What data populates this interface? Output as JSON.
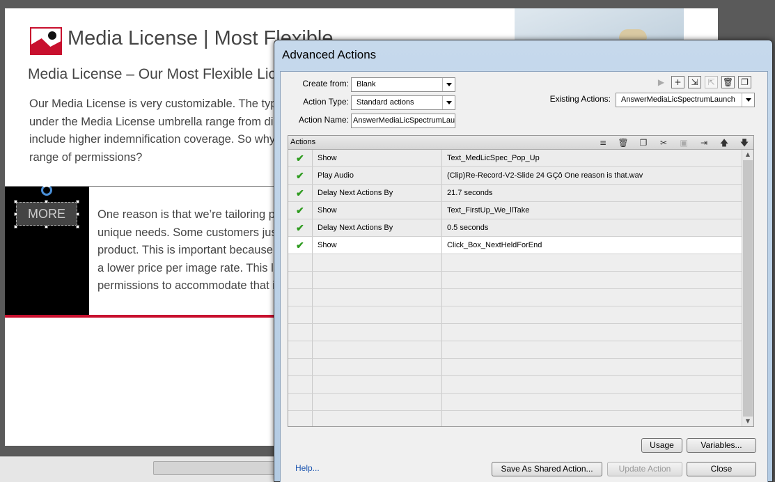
{
  "slide": {
    "title": "Media License | Most Flexible",
    "subtitle": "Media License – Our Most Flexible Lice",
    "body_lines": [
      "Our Media License is very customizable.  The type",
      "under the Media License umbrella range from dig",
      "include higher indemnification coverage.  So why",
      "range of permissions?"
    ],
    "more_button": "MORE",
    "body2_lines": [
      "One reason is that we’re tailoring pr",
      "unique needs.  Some customers jus",
      "product.  This is important because",
      "a lower price per image rate.  This li",
      "permissions to accommodate that i"
    ]
  },
  "dialog": {
    "title": "Advanced Actions",
    "create_from_label": "Create from:",
    "create_from_value": "Blank",
    "action_type_label": "Action Type:",
    "action_type_value": "Standard actions",
    "action_name_label": "Action Name:",
    "action_name_value": "AnswerMediaLicSpectrumLaun",
    "existing_actions_label": "Existing Actions:",
    "existing_actions_value": "AnswerMediaLicSpectrumLaunch",
    "actions_header": "Actions",
    "rows": [
      {
        "action": "Show",
        "target": "Text_MedLicSpec_Pop_Up"
      },
      {
        "action": "Play Audio",
        "target": "(Clip)Re-Record-V2-Slide 24 GÇô One reason is that.wav"
      },
      {
        "action": "Delay Next Actions By",
        "target": "21.7    seconds"
      },
      {
        "action": "Show",
        "target": "Text_FirstUp_We_llTake"
      },
      {
        "action": "Delay Next Actions By",
        "target": "0.5    seconds"
      },
      {
        "action": "Show",
        "target": "Click_Box_NextHeldForEnd"
      }
    ],
    "usage_button": "Usage",
    "variables_button": "Variables...",
    "help_link": "Help...",
    "save_shared_button": "Save As Shared Action...",
    "update_button": "Update Action",
    "close_button": "Close"
  }
}
